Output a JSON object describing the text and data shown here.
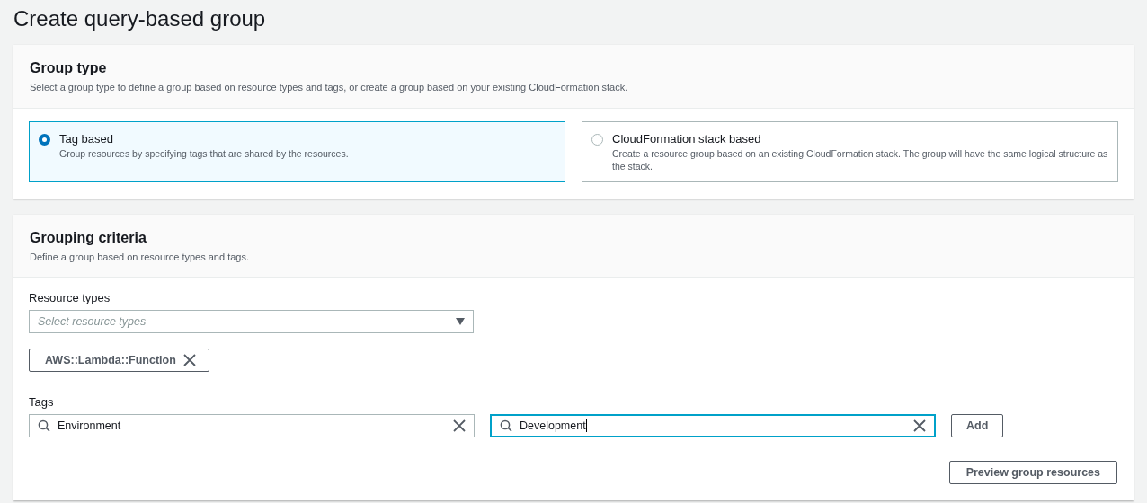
{
  "page_title": "Create query-based group",
  "group_type": {
    "title": "Group type",
    "description": "Select a group type to define a group based on resource types and tags, or create a group based on your existing CloudFormation stack.",
    "options": [
      {
        "label": "Tag based",
        "description": "Group resources by specifying tags that are shared by the resources.",
        "selected": true
      },
      {
        "label": "CloudFormation stack based",
        "description": "Create a resource group based on an existing CloudFormation stack. The group will have the same logical structure as the stack.",
        "selected": false
      }
    ]
  },
  "grouping_criteria": {
    "title": "Grouping criteria",
    "description": "Define a group based on resource types and tags.",
    "resource_types": {
      "label": "Resource types",
      "placeholder": "Select resource types",
      "tokens": [
        "AWS::Lambda::Function"
      ]
    },
    "tags": {
      "label": "Tags",
      "fields": [
        {
          "value": "Environment",
          "focused": false
        },
        {
          "value": "Development",
          "focused": true
        }
      ],
      "add_button": "Add"
    },
    "preview_button": "Preview group resources"
  }
}
